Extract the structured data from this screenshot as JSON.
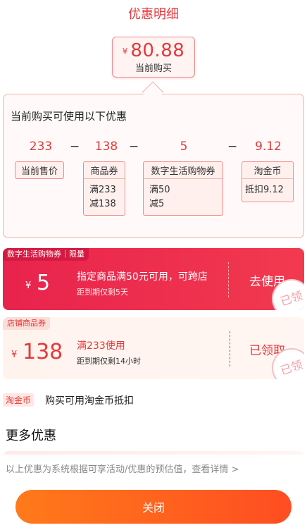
{
  "header": {
    "title": "优惠明细"
  },
  "price": {
    "currency": "¥",
    "value": "80.88",
    "caption": "当前购买"
  },
  "breakdown": {
    "title": "当前购买可使用以下优惠",
    "items": [
      {
        "amount": "233",
        "label": "当前售价",
        "lines": []
      },
      {
        "amount": "138",
        "label": "商品券",
        "lines": [
          "满233",
          "减138"
        ]
      },
      {
        "amount": "5",
        "label": "数字生活购物券",
        "lines": [
          "满50",
          "减5"
        ]
      },
      {
        "amount": "9.12",
        "label": "淘金币",
        "lines": [
          "抵扣9.12"
        ]
      }
    ],
    "operator": "−"
  },
  "coupons": [
    {
      "label": "数字生活购物券｜限量",
      "currency": "¥",
      "amount": "5",
      "main": "指定商品满50元可用，可跨店",
      "sub": "距到期仅剩5天",
      "action": "去使用",
      "stamp": "已领"
    },
    {
      "label": "店铺商品券",
      "currency": "¥",
      "amount": "138",
      "main": "满233使用",
      "sub": "距到期仅剩14小时",
      "action": "已领取",
      "stamp": "已领"
    }
  ],
  "coin_row": {
    "tag": "淘金币",
    "text": "购买可用淘金币抵扣"
  },
  "more": {
    "title": "更多优惠"
  },
  "footer": {
    "note": "以上优惠为系统根据可享活动/优惠的预估值，查看详情 >",
    "close_label": "关闭"
  },
  "colors": {
    "accent": "#e4393c",
    "coupon_red": "#e8234d",
    "button_orange": "#ff5a1f"
  },
  "icons": {
    "detail_arrow": "chevron-right-icon"
  }
}
